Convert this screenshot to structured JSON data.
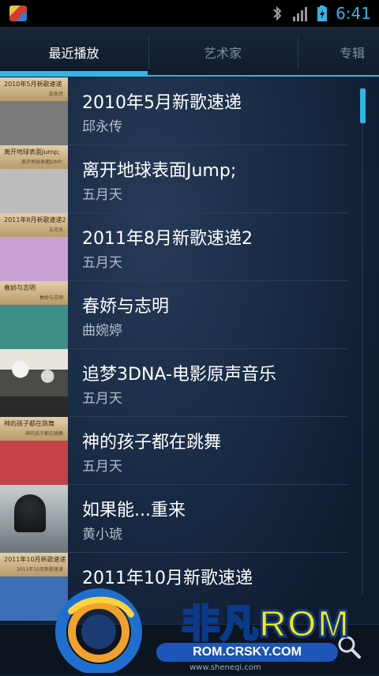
{
  "status_bar": {
    "time": "6:41",
    "icons": [
      "notification-app-icon",
      "bluetooth-icon",
      "signal-icon",
      "battery-charging-icon"
    ]
  },
  "tabs": [
    {
      "label": "最近播放",
      "active": true
    },
    {
      "label": "艺术家",
      "active": false
    },
    {
      "label": "专辑",
      "active": false
    }
  ],
  "albums": [
    {
      "title": "2010年5月新歌速递",
      "artist": "邱永传",
      "cover_text": "2010年5月新歌速递",
      "cover_sub": "邱永传",
      "cover_color": "#7a7a7a"
    },
    {
      "title": "离开地球表面Jump;",
      "artist": "五月天",
      "cover_text": "离开地球表面Jump;",
      "cover_sub": "离开地球表面JUMP;",
      "cover_color": "#bcbcbc"
    },
    {
      "title": "2011年8月新歌速递2",
      "artist": "五月天",
      "cover_text": "2011年8月新歌速递2",
      "cover_sub": "五月天",
      "cover_color": "#c9a3d6"
    },
    {
      "title": "春娇与志明",
      "artist": "曲婉婷",
      "cover_text": "春娇与志明",
      "cover_sub": "春娇与志明",
      "cover_color": "#3e8f87"
    },
    {
      "title": "追梦3DNA-电影原声音乐",
      "artist": "五月天",
      "cover_text": "",
      "cover_sub": "",
      "cover_color": "#4a4a46"
    },
    {
      "title": "神的孩子都在跳舞",
      "artist": "五月天",
      "cover_text": "神的孩子都在跳舞",
      "cover_sub": "神的孩子都在跳舞",
      "cover_color": "#c4434a"
    },
    {
      "title": "如果能...重来",
      "artist": "黄小琥",
      "cover_text": "",
      "cover_sub": "",
      "cover_color": "#9aa3a8"
    },
    {
      "title": "2011年10月新歌速递",
      "artist": "",
      "cover_text": "2011年10月新歌速递",
      "cover_sub": "2011年10月新歌速递",
      "cover_color": "#3c6fb6"
    }
  ],
  "watermark": {
    "title_a": "非凡",
    "title_b": "ROM",
    "url": "ROM.CRSKY.COM",
    "small_url": "www.sheneqi.com"
  },
  "colors": {
    "accent": "#33b5e5",
    "background": "#182a43"
  }
}
